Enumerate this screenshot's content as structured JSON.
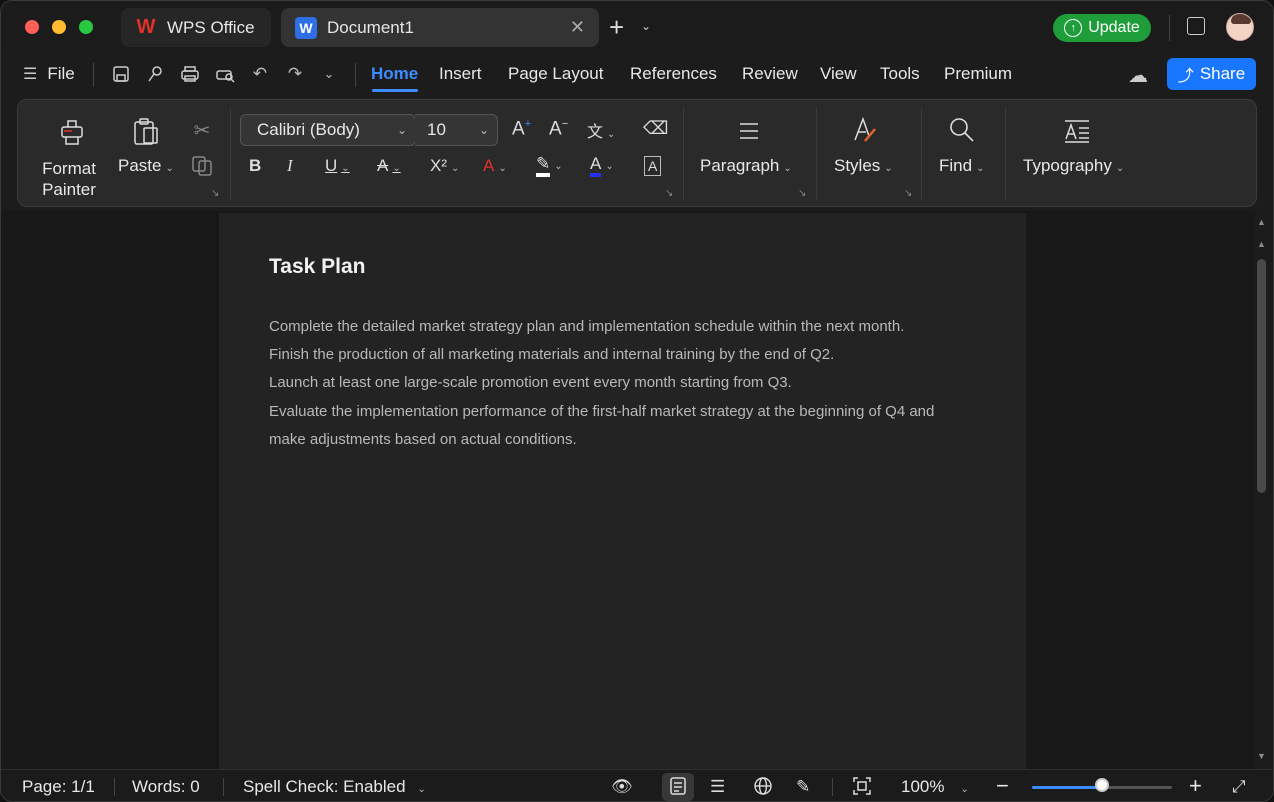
{
  "titlebar": {
    "tabs": [
      {
        "label": "WPS Office",
        "icon": "wps-logo-icon"
      },
      {
        "label": "Document1",
        "icon": "word-doc-icon"
      }
    ],
    "update_label": "Update"
  },
  "menubar": {
    "file_label": "File",
    "tabs": [
      "Home",
      "Insert",
      "Page Layout",
      "References",
      "Review",
      "View",
      "Tools",
      "Premium"
    ],
    "active_tab": "Home",
    "share_label": "Share"
  },
  "ribbon": {
    "format_painter": "Format\nPainter",
    "paste": "Paste",
    "font_name": "Calibri (Body)",
    "font_size": "10",
    "paragraph": "Paragraph",
    "styles": "Styles",
    "find": "Find",
    "typography": "Typography"
  },
  "document": {
    "title": "Task Plan",
    "paragraphs": [
      "Complete the detailed market strategy plan and implementation schedule within the next month.",
      "Finish the production of all marketing materials and internal training by the end of Q2.",
      "Launch at least one large-scale promotion event every month starting from Q3.",
      "Evaluate the implementation performance of the first-half market strategy at the beginning of Q4 and make adjustments based on actual conditions."
    ]
  },
  "statusbar": {
    "page": "Page: 1/1",
    "words": "Words: 0",
    "spell_check": "Spell Check: Enabled",
    "zoom": "100%",
    "zoom_level": 0.5
  },
  "colors": {
    "accent": "#3d8bff",
    "update_green": "#1f9d3b",
    "share_blue": "#1976ff"
  }
}
